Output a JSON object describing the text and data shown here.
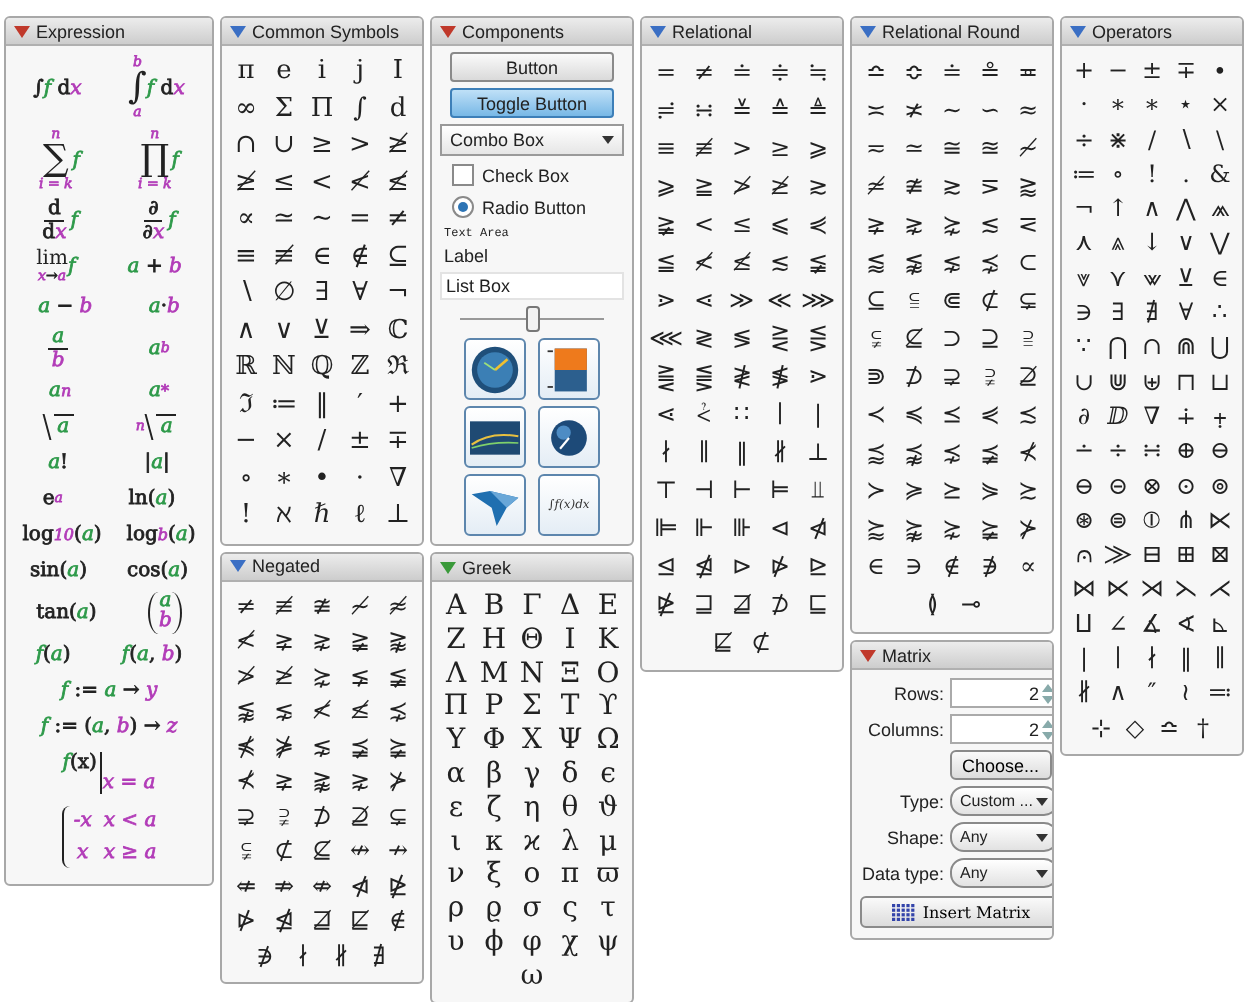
{
  "expression": {
    "title": "Expression",
    "color": "#c0392b",
    "rows": [
      [
        {
          "kind": "row",
          "parts": [
            {
              "text": "∫",
              "color": "#222222"
            },
            {
              "text": "f",
              "color": "#2e9a4a"
            },
            {
              "text": " d",
              "color": "#222222"
            },
            {
              "text": "x",
              "color": "#b23cb8"
            }
          ]
        },
        {
          "kind": "bigop",
          "op": "∫",
          "upper": [
            {
              "text": "b",
              "color": "#b23cb8"
            }
          ],
          "lower": [
            {
              "text": "a",
              "color": "#b23cb8"
            }
          ],
          "body": [
            {
              "text": "f",
              "color": "#2e9a4a"
            },
            {
              "text": " d",
              "color": "#222222"
            },
            {
              "text": "x",
              "color": "#b23cb8"
            }
          ]
        }
      ],
      [
        {
          "kind": "bigop",
          "op": "∑",
          "upper": [
            {
              "text": "n",
              "color": "#b23cb8"
            }
          ],
          "lower": [
            {
              "text": "i = k",
              "color": "#b23cb8"
            }
          ],
          "body": [
            {
              "text": "f",
              "color": "#2e9a4a"
            }
          ]
        },
        {
          "kind": "bigop",
          "op": "∏",
          "upper": [
            {
              "text": "n",
              "color": "#b23cb8"
            }
          ],
          "lower": [
            {
              "text": "i = k",
              "color": "#b23cb8"
            }
          ],
          "body": [
            {
              "text": "f",
              "color": "#2e9a4a"
            }
          ]
        }
      ],
      [
        {
          "kind": "frac",
          "num": [
            {
              "text": "d",
              "color": "#222222"
            }
          ],
          "den": [
            {
              "text": "d",
              "color": "#222222"
            },
            {
              "text": "x",
              "color": "#b23cb8"
            }
          ],
          "after": [
            {
              "text": "f",
              "color": "#2e9a4a"
            }
          ]
        },
        {
          "kind": "frac",
          "num": [
            {
              "text": "∂",
              "color": "#222222"
            }
          ],
          "den": [
            {
              "text": "∂",
              "color": "#222222"
            },
            {
              "text": "x",
              "color": "#b23cb8"
            }
          ],
          "after": [
            {
              "text": "f",
              "color": "#2e9a4a"
            }
          ]
        }
      ],
      [
        {
          "kind": "limit",
          "op": "lim",
          "lower": [
            {
              "text": "x",
              "color": "#b23cb8"
            },
            {
              "text": "→",
              "color": "#222222"
            },
            {
              "text": "a",
              "color": "#b23cb8"
            }
          ],
          "body": [
            {
              "text": "f",
              "color": "#2e9a4a"
            }
          ]
        },
        {
          "kind": "row",
          "parts": [
            {
              "text": "a",
              "color": "#2e9a4a"
            },
            {
              "text": " + ",
              "color": "#222222"
            },
            {
              "text": "b",
              "color": "#b23cb8"
            }
          ]
        }
      ],
      [
        {
          "kind": "row",
          "parts": [
            {
              "text": "a",
              "color": "#2e9a4a"
            },
            {
              "text": " − ",
              "color": "#222222"
            },
            {
              "text": "b",
              "color": "#b23cb8"
            }
          ]
        },
        {
          "kind": "row",
          "parts": [
            {
              "text": "a",
              "color": "#2e9a4a"
            },
            {
              "text": "·",
              "color": "#222222"
            },
            {
              "text": "b",
              "color": "#b23cb8"
            }
          ]
        }
      ],
      [
        {
          "kind": "frac",
          "num": [
            {
              "text": "a",
              "color": "#2e9a4a"
            }
          ],
          "den": [
            {
              "text": "b",
              "color": "#b23cb8"
            }
          ]
        },
        {
          "kind": "script",
          "base": [
            {
              "text": "a",
              "color": "#2e9a4a"
            }
          ],
          "sup": [
            {
              "text": "b",
              "color": "#b23cb8"
            }
          ]
        }
      ],
      [
        {
          "kind": "script",
          "base": [
            {
              "text": "a",
              "color": "#2e9a4a"
            }
          ],
          "sub": [
            {
              "text": "n",
              "color": "#b23cb8"
            }
          ]
        },
        {
          "kind": "script",
          "base": [
            {
              "text": "a",
              "color": "#2e9a4a"
            }
          ],
          "sub": [
            {
              "text": "*",
              "color": "#b23cb8"
            }
          ]
        }
      ],
      [
        {
          "kind": "root",
          "body": [
            {
              "text": "a",
              "color": "#2e9a4a"
            }
          ]
        },
        {
          "kind": "root",
          "index": [
            {
              "text": "n",
              "color": "#b23cb8"
            }
          ],
          "body": [
            {
              "text": "a",
              "color": "#2e9a4a"
            }
          ]
        }
      ],
      [
        {
          "kind": "row",
          "parts": [
            {
              "text": "a",
              "color": "#2e9a4a"
            },
            {
              "text": "!",
              "color": "#222222"
            }
          ]
        },
        {
          "kind": "row",
          "parts": [
            {
              "text": "|",
              "color": "#222222"
            },
            {
              "text": "a",
              "color": "#2e9a4a"
            },
            {
              "text": "|",
              "color": "#222222"
            }
          ]
        }
      ],
      [
        {
          "kind": "script",
          "base": [
            {
              "text": "e",
              "color": "#222222"
            }
          ],
          "sup": [
            {
              "text": "a",
              "color": "#b23cb8"
            }
          ]
        },
        {
          "kind": "row",
          "parts": [
            {
              "text": "ln(",
              "color": "#222222"
            },
            {
              "text": "a",
              "color": "#2e9a4a"
            },
            {
              "text": ")",
              "color": "#222222"
            }
          ]
        }
      ],
      [
        {
          "kind": "script",
          "base": [
            {
              "text": "log",
              "color": "#222222"
            }
          ],
          "sub": [
            {
              "text": "10",
              "color": "#b23cb8"
            }
          ],
          "after": [
            {
              "text": "(",
              "color": "#222222"
            },
            {
              "text": "a",
              "color": "#2e9a4a"
            },
            {
              "text": ")",
              "color": "#222222"
            }
          ]
        },
        {
          "kind": "script",
          "base": [
            {
              "text": "log",
              "color": "#222222"
            }
          ],
          "sub": [
            {
              "text": "b",
              "color": "#b23cb8"
            }
          ],
          "after": [
            {
              "text": "(",
              "color": "#222222"
            },
            {
              "text": "a",
              "color": "#2e9a4a"
            },
            {
              "text": ")",
              "color": "#222222"
            }
          ]
        }
      ],
      [
        {
          "kind": "row",
          "parts": [
            {
              "text": "sin(",
              "color": "#222222"
            },
            {
              "text": "a",
              "color": "#2e9a4a"
            },
            {
              "text": ")",
              "color": "#222222"
            }
          ]
        },
        {
          "kind": "row",
          "parts": [
            {
              "text": "cos(",
              "color": "#222222"
            },
            {
              "text": "a",
              "color": "#2e9a4a"
            },
            {
              "text": ")",
              "color": "#222222"
            }
          ]
        }
      ],
      [
        {
          "kind": "row",
          "parts": [
            {
              "text": "tan(",
              "color": "#222222"
            },
            {
              "text": "a",
              "color": "#2e9a4a"
            },
            {
              "text": ")",
              "color": "#222222"
            }
          ]
        },
        {
          "kind": "binom",
          "top": [
            {
              "text": "a",
              "color": "#2e9a4a"
            }
          ],
          "bottom": [
            {
              "text": "b",
              "color": "#b23cb8"
            }
          ]
        }
      ],
      [
        {
          "kind": "row",
          "parts": [
            {
              "text": "f",
              "color": "#2e9a4a"
            },
            {
              "text": "(",
              "color": "#222222"
            },
            {
              "text": "a",
              "color": "#2e9a4a"
            },
            {
              "text": ")",
              "color": "#222222"
            }
          ]
        },
        {
          "kind": "row",
          "parts": [
            {
              "text": "f",
              "color": "#2e9a4a"
            },
            {
              "text": "(",
              "color": "#222222"
            },
            {
              "text": "a",
              "color": "#2e9a4a"
            },
            {
              "text": ", ",
              "color": "#222222"
            },
            {
              "text": "b",
              "color": "#b23cb8"
            },
            {
              "text": ")",
              "color": "#222222"
            }
          ]
        }
      ],
      [
        {
          "kind": "row",
          "parts": [
            {
              "text": "f",
              "color": "#2e9a4a"
            },
            {
              "text": " := ",
              "color": "#222222"
            },
            {
              "text": "a",
              "color": "#2e9a4a"
            },
            {
              "text": " → ",
              "color": "#222222"
            },
            {
              "text": "y",
              "color": "#b23cb8"
            }
          ]
        }
      ],
      [
        {
          "kind": "row",
          "parts": [
            {
              "text": "f",
              "color": "#2e9a4a"
            },
            {
              "text": " := (",
              "color": "#222222"
            },
            {
              "text": "a",
              "color": "#2e9a4a"
            },
            {
              "text": ", ",
              "color": "#222222"
            },
            {
              "text": "b",
              "color": "#b23cb8"
            },
            {
              "text": ") → ",
              "color": "#222222"
            },
            {
              "text": "z",
              "color": "#b23cb8"
            }
          ]
        }
      ],
      [
        {
          "kind": "eval",
          "body": [
            {
              "text": "f",
              "color": "#2e9a4a"
            },
            {
              "text": "(x)",
              "color": "#222222"
            }
          ],
          "at": [
            {
              "text": "x = a",
              "color": "#b23cb8"
            }
          ]
        }
      ],
      [
        {
          "kind": "cases",
          "rows": [
            [
              [
                {
                  "text": "-x",
                  "color": "#b23cb8"
                }
              ],
              [
                {
                  "text": "x < a",
                  "color": "#b23cb8"
                }
              ]
            ],
            [
              [
                {
                  "text": "x",
                  "color": "#b23cb8"
                }
              ],
              [
                {
                  "text": "x ≥ a",
                  "color": "#b23cb8"
                }
              ]
            ]
          ]
        }
      ]
    ]
  },
  "common_symbols": {
    "title": "Common Symbols",
    "color": "#3b6fc4",
    "rows": [
      [
        "π",
        "e",
        "i",
        "j",
        "I"
      ],
      [
        "∞",
        "Σ",
        "Π",
        "∫",
        "d"
      ],
      [
        "∩",
        "∪",
        "≥",
        ">",
        "≱"
      ],
      [
        "≱",
        "≤",
        "<",
        "≮",
        "≰"
      ],
      [
        "∝",
        "≃",
        "∼",
        "=",
        "≠"
      ],
      [
        "≡",
        "≢",
        "∈",
        "∉",
        "⊆"
      ],
      [
        "∖",
        "∅",
        "∃",
        "∀",
        "¬"
      ],
      [
        "∧",
        "∨",
        "⊻",
        "⇒",
        "ℂ"
      ],
      [
        "ℝ",
        "ℕ",
        "ℚ",
        "ℤ",
        "ℜ"
      ],
      [
        "ℑ",
        "≔",
        "‖",
        "′",
        "+"
      ],
      [
        "−",
        "×",
        "/",
        "±",
        "∓"
      ],
      [
        "∘",
        "∗",
        "•",
        "·",
        "∇"
      ],
      [
        "!",
        "ℵ",
        "ℏ",
        "ℓ",
        "⊥"
      ]
    ]
  },
  "negated": {
    "title": "Negated",
    "color": "#3b6fc4",
    "rows": [
      [
        "≠",
        "≢",
        "≇",
        "≁",
        "≉"
      ],
      [
        "≮",
        "⪈",
        "⋧",
        "≩",
        "⪊"
      ],
      [
        "≯",
        "≱",
        "⋩",
        "⪇",
        "≨"
      ],
      [
        "⪉",
        "⋦",
        "≮",
        "≰",
        "⋨"
      ],
      [
        "⋠",
        "⋡",
        "⋦",
        "⪵",
        "⪶"
      ],
      [
        "⊀",
        "⪈",
        "⪊",
        "⋧",
        "⊁"
      ],
      [
        "⊋",
        "⫌",
        "⊅",
        "⊉",
        "⊊"
      ],
      [
        "⫋",
        "⊄",
        "⊈",
        "↮",
        "↛"
      ],
      [
        "⇍",
        "⇏",
        "⇎",
        "⋪",
        "⋭"
      ],
      [
        "⋫",
        "⋬",
        "⋣",
        "⋢",
        "∉"
      ],
      [
        "∌",
        "∤",
        "∦",
        "∄"
      ]
    ]
  },
  "components": {
    "title": "Components",
    "color": "#c0392b",
    "button": "Button",
    "toggle_button": {
      "label": "Toggle Button",
      "selected": true
    },
    "combo_box": {
      "value": "Combo Box"
    },
    "check_box": {
      "label": "Check Box",
      "checked": false
    },
    "radio_button": {
      "label": "Radio Button",
      "selected": true
    },
    "text_area": "Text Area",
    "label": "Label",
    "list_box": "List Box",
    "slider": {
      "level": 0.5
    },
    "tiles": [
      {
        "kind": "gauge"
      },
      {
        "kind": "meter"
      },
      {
        "kind": "plot"
      },
      {
        "kind": "knob"
      },
      {
        "kind": "surface"
      },
      {
        "kind": "text",
        "text": "∫f(x)dx"
      }
    ]
  },
  "greek": {
    "title": "Greek",
    "color": "#3a9a3a",
    "rows": [
      [
        "Α",
        "Β",
        "Γ",
        "Δ",
        "Ε"
      ],
      [
        "Ζ",
        "Η",
        "Θ",
        "Ι",
        "Κ"
      ],
      [
        "Λ",
        "Μ",
        "Ν",
        "Ξ",
        "Ο"
      ],
      [
        "Π",
        "Ρ",
        "Σ",
        "Τ",
        "ϒ"
      ],
      [
        "Υ",
        "Φ",
        "Χ",
        "Ψ",
        "Ω"
      ],
      [
        "α",
        "β",
        "γ",
        "δ",
        "ϵ"
      ],
      [
        "ε",
        "ζ",
        "η",
        "θ",
        "ϑ"
      ],
      [
        "ι",
        "κ",
        "ϰ",
        "λ",
        "μ"
      ],
      [
        "ν",
        "ξ",
        "ο",
        "π",
        "ϖ"
      ],
      [
        "ρ",
        "ϱ",
        "σ",
        "ς",
        "τ"
      ],
      [
        "υ",
        "ϕ",
        "φ",
        "χ",
        "ψ"
      ],
      [
        "",
        "",
        "ω",
        "",
        ""
      ]
    ]
  },
  "relational": {
    "title": "Relational",
    "color": "#3b6fc4",
    "rows": [
      [
        "=",
        "≠",
        "≐",
        "≑",
        "≒"
      ],
      [
        "≓",
        "∺",
        "≚",
        "≙",
        "≜"
      ],
      [
        "≡",
        "≢",
        ">",
        "≥",
        "⩾"
      ],
      [
        "⩾",
        "≧",
        "≯",
        "≱",
        "≳"
      ],
      [
        "≩",
        "<",
        "≤",
        "⩽",
        "⋞"
      ],
      [
        "≦",
        "≮",
        "≰",
        "≲",
        "≨"
      ],
      [
        "⋗",
        "⋖",
        "≫",
        "≪",
        "⋙"
      ],
      [
        "⋘",
        "≷",
        "≶",
        "⋛",
        "⋚"
      ],
      [
        "⪌",
        "⪋",
        "≹",
        "≸",
        "⋗"
      ],
      [
        "⋖",
        "⩻",
        "∷",
        "∣",
        "|"
      ],
      [
        "∤",
        "∥",
        "‖",
        "∦",
        "⊥"
      ],
      [
        "⊤",
        "⊣",
        "⊢",
        "⊨",
        "⫫"
      ],
      [
        "⊫",
        "⊩",
        "⊪",
        "⊲",
        "⋪"
      ],
      [
        "⊴",
        "⋬",
        "⊳",
        "⋫",
        "⊵"
      ],
      [
        "⋭",
        "⊒",
        "⋣",
        "⊅",
        "⊑"
      ],
      [
        "⋢",
        "⊄"
      ]
    ]
  },
  "relational_round": {
    "title": "Relational Round",
    "color": "#3b6fc4",
    "rows": [
      [
        "≏",
        "≎",
        "≐",
        "≗",
        "≖"
      ],
      [
        "≍",
        "≭",
        "∼",
        "∽",
        "≈"
      ],
      [
        "≂",
        "≃",
        "≅",
        "≊",
        "≁"
      ],
      [
        "≄",
        "≇",
        "≳",
        "⋝",
        "⪆"
      ],
      [
        "⪈",
        "⋧",
        "⋩",
        "≲",
        "⋜"
      ],
      [
        "⪅",
        "⪉",
        "⋦",
        "⋨",
        "⊂"
      ],
      [
        "⊆",
        "⫅",
        "⋐",
        "⊄",
        "⊊"
      ],
      [
        "⫋",
        "⊈",
        "⊃",
        "⊇",
        "⫆"
      ],
      [
        "⋑",
        "⊅",
        "⊋",
        "⫌",
        "⊉"
      ],
      [
        "≺",
        "≼",
        "⪯",
        "⋞",
        "≾"
      ],
      [
        "⪷",
        "⪹",
        "⋨",
        "⪵",
        "⊀"
      ],
      [
        "≻",
        "≽",
        "⪰",
        "⋟",
        "≿"
      ],
      [
        "⪸",
        "⪺",
        "⋩",
        "⪶",
        "⊁"
      ],
      [
        "∈",
        "∋",
        "∉",
        "∌",
        "∝"
      ],
      [
        "≬",
        "⊸"
      ]
    ]
  },
  "matrix": {
    "title": "Matrix",
    "color": "#c0392b",
    "rows_label": "Rows:",
    "rows_value": "2",
    "columns_label": "Columns:",
    "columns_value": "2",
    "choose_button": "Choose...",
    "type_label": "Type:",
    "type_value": "Custom ...",
    "shape_label": "Shape:",
    "shape_value": "Any",
    "data_type_label": "Data type:",
    "data_type_value": "Any",
    "insert_button": "Insert Matrix"
  },
  "operators": {
    "title": "Operators",
    "color": "#3b6fc4",
    "rows": [
      [
        "+",
        "−",
        "±",
        "∓",
        "∙"
      ],
      [
        "·",
        "∗",
        "∗",
        "⋆",
        "×"
      ],
      [
        "÷",
        "⋇",
        "∕",
        "∖",
        "\\"
      ],
      [
        "≔",
        "∘",
        "!",
        ".",
        "&"
      ],
      [
        "¬",
        "↑",
        "∧",
        "⋀",
        "⩕"
      ],
      [
        "⋏",
        "⩓",
        "↓",
        "∨",
        "⋁"
      ],
      [
        "⩔",
        "⋎",
        "⩖",
        "⊻",
        "∈"
      ],
      [
        "∋",
        "∃",
        "∄",
        "∀",
        "∴"
      ],
      [
        "∵",
        "⋂",
        "∩",
        "⋒",
        "⋃"
      ],
      [
        "∪",
        "⋓",
        "⊎",
        "⊓",
        "⊔"
      ],
      [
        "∂",
        "ⅅ",
        "∇",
        "∔",
        "⨥"
      ],
      [
        "∸",
        "÷",
        "∺",
        "⊕",
        "⊖"
      ],
      [
        "⊖",
        "⊝",
        "⊗",
        "⊙",
        "⊚"
      ],
      [
        "⊛",
        "⊜",
        "⦶",
        "⋔",
        "⋉"
      ],
      [
        "⩀",
        "⨠",
        "⊟",
        "⊞",
        "⊠"
      ],
      [
        "⋈",
        "⋉",
        "⋊",
        "⋋",
        "⋌"
      ],
      [
        "⨿",
        "∠",
        "∡",
        "∢",
        "⊾"
      ],
      [
        "|",
        "∣",
        "∤",
        "‖",
        "∥"
      ],
      [
        "∦",
        "∧",
        "″",
        "≀",
        "≕"
      ],
      [
        "⊹",
        "◇",
        "≏",
        "†"
      ]
    ]
  }
}
